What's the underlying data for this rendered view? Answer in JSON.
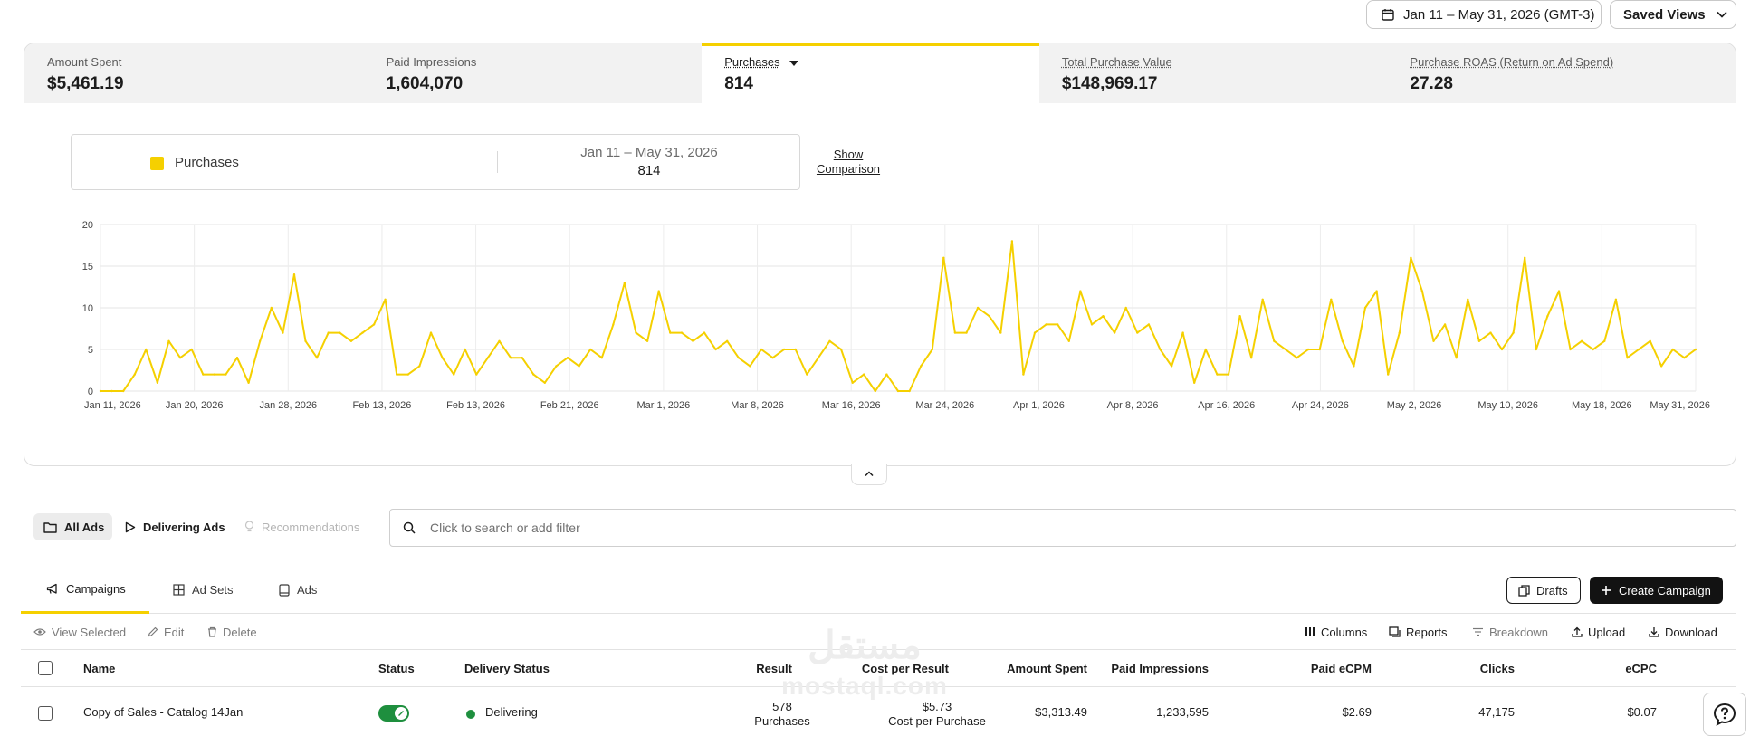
{
  "header": {
    "date_range": "Jan 11 – May 31, 2026 (GMT-3)",
    "saved_views": "Saved Views"
  },
  "metrics": [
    {
      "label": "Amount Spent",
      "value": "$5,461.19"
    },
    {
      "label": "Paid Impressions",
      "value": "1,604,070"
    },
    {
      "label": "Purchases",
      "value": "814"
    },
    {
      "label": "Total Purchase Value",
      "value": "$148,969.17"
    },
    {
      "label": "Purchase ROAS (Return on Ad Spend)",
      "value": "27.28"
    }
  ],
  "legend": {
    "series_name": "Purchases",
    "range": "Jan 11 – May 31, 2026",
    "total": "814",
    "show_comparison": "Show Comparison"
  },
  "chart_data": {
    "type": "line",
    "ylim": [
      0,
      20
    ],
    "y_ticks": [
      "0",
      "5",
      "10",
      "15",
      "20"
    ],
    "x_tick_labels": [
      "Jan 11, 2026",
      "Jan 20, 2026",
      "Jan 28, 2026",
      "Feb 13, 2026",
      "Feb 13, 2026",
      "Feb 21, 2026",
      "Mar 1, 2026",
      "Mar 8, 2026",
      "Mar 16, 2026",
      "Mar 24, 2026",
      "Apr 1, 2026",
      "Apr 8, 2026",
      "Apr 16, 2026",
      "Apr 24, 2026",
      "May 2, 2026",
      "May 10, 2026",
      "May 18, 2026",
      "May 31, 2026"
    ],
    "grid": true,
    "color": "#f5d000",
    "series": [
      {
        "name": "Purchases",
        "values": [
          0,
          0,
          0,
          2,
          5,
          1,
          6,
          4,
          5,
          2,
          2,
          2,
          4,
          1,
          6,
          10,
          7,
          14,
          6,
          4,
          7,
          7,
          6,
          7,
          8,
          11,
          2,
          2,
          3,
          7,
          4,
          2,
          5,
          2,
          4,
          6,
          4,
          4,
          2,
          1,
          3,
          4,
          3,
          5,
          4,
          8,
          13,
          7,
          6,
          12,
          7,
          7,
          6,
          7,
          5,
          6,
          4,
          3,
          5,
          4,
          5,
          5,
          2,
          4,
          6,
          5,
          1,
          2,
          0,
          2,
          0,
          0,
          3,
          5,
          16,
          7,
          7,
          10,
          9,
          7,
          18,
          2,
          7,
          8,
          8,
          6,
          12,
          8,
          9,
          7,
          10,
          7,
          8,
          5,
          3,
          7,
          1,
          5,
          2,
          2,
          9,
          4,
          11,
          6,
          5,
          4,
          5,
          5,
          11,
          6,
          3,
          10,
          12,
          2,
          7,
          16,
          12,
          6,
          8,
          4,
          11,
          6,
          7,
          5,
          7,
          16,
          5,
          9,
          12,
          5,
          6,
          5,
          6,
          11,
          4,
          5,
          6,
          3,
          5,
          4,
          5
        ]
      }
    ]
  },
  "filters": {
    "all_ads": "All Ads",
    "delivering_ads": "Delivering Ads",
    "recommendations": "Recommendations",
    "search_placeholder": "Click to search or add filter"
  },
  "levels": {
    "campaigns": "Campaigns",
    "ad_sets": "Ad Sets",
    "ads": "Ads",
    "drafts": "Drafts",
    "create_campaign": "Create Campaign"
  },
  "toolbar": {
    "view_selected": "View Selected",
    "edit": "Edit",
    "delete": "Delete",
    "columns": "Columns",
    "reports": "Reports",
    "breakdown": "Breakdown",
    "upload": "Upload",
    "download": "Download"
  },
  "table": {
    "headers": {
      "name": "Name",
      "status": "Status",
      "delivery_status": "Delivery Status",
      "result": "Result",
      "cost_per_result": "Cost per Result",
      "amount_spent": "Amount Spent",
      "paid_impressions": "Paid Impressions",
      "paid_ecpm": "Paid eCPM",
      "clicks": "Clicks",
      "ecpc": "eCPC"
    },
    "rows": [
      {
        "name": "Copy of Sales - Catalog 14Jan",
        "status_on": true,
        "delivery_status": "Delivering",
        "result": "578",
        "result_sub": "Purchases",
        "cost_per_result": "$5.73",
        "cost_per_result_sub": "Cost per Purchase",
        "amount_spent": "$3,313.49",
        "paid_impressions": "1,233,595",
        "paid_ecpm": "$2.69",
        "clicks": "47,175",
        "ecpc": "$0.07"
      }
    ]
  },
  "watermark": {
    "text": "مستقل",
    "subtext": "mostaql.com"
  }
}
